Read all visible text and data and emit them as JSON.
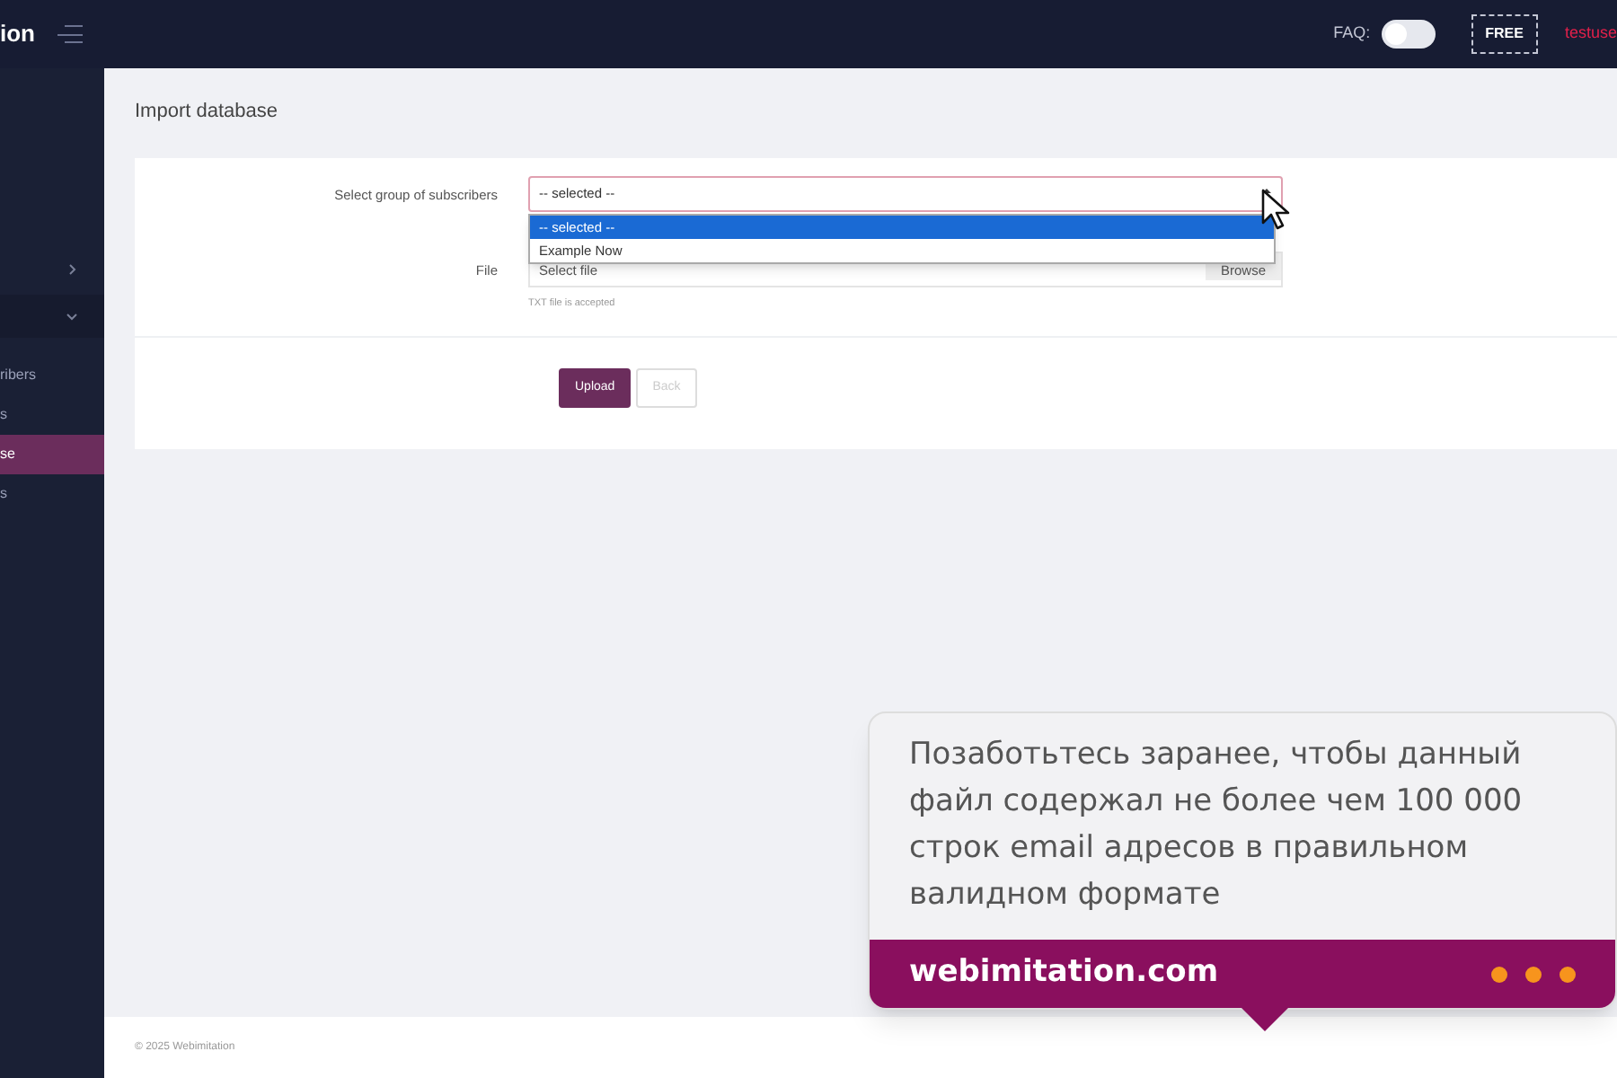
{
  "header": {
    "logo": "ion",
    "faq_label": "FAQ:",
    "faq_toggle": {
      "on": false
    },
    "plan_badge": "FREE",
    "user": "testuse"
  },
  "sidebar": {
    "items": [
      {
        "kind": "collapsed",
        "selected": false
      },
      {
        "kind": "expanded",
        "selected": false
      },
      {
        "label": "ribers",
        "kind": "link",
        "selected": false
      },
      {
        "label": "s",
        "kind": "link",
        "selected": false
      },
      {
        "label": "se",
        "kind": "link",
        "selected": true
      },
      {
        "label": "s",
        "kind": "link",
        "selected": false
      }
    ]
  },
  "page_title": "Import database",
  "form": {
    "group_label": "Select group of subscribers",
    "group_select": {
      "value": "-- selected --",
      "expanded": true,
      "options": [
        {
          "label": "-- selected --",
          "selected": true
        },
        {
          "label": "Example Now",
          "selected": false
        }
      ]
    },
    "file_label": "File",
    "file_placeholder": "Select file",
    "browse": "Browse",
    "file_hint": "TXT file is accepted",
    "buttons": [
      {
        "label": "Upload",
        "kind": "primary"
      },
      {
        "label": "Back",
        "kind": "secondary"
      }
    ]
  },
  "footer": "© 2025 Webimitation",
  "callout": {
    "text": "Позаботьтесь заранее, чтобы данный файл содержал не более чем 100 000 строк email адресов в правильном валидном формате",
    "site": "webimitation.com",
    "dots": [
      {
        "color": "#f7941d"
      },
      {
        "color": "#f7941d"
      },
      {
        "color": "#f7941d"
      }
    ]
  }
}
